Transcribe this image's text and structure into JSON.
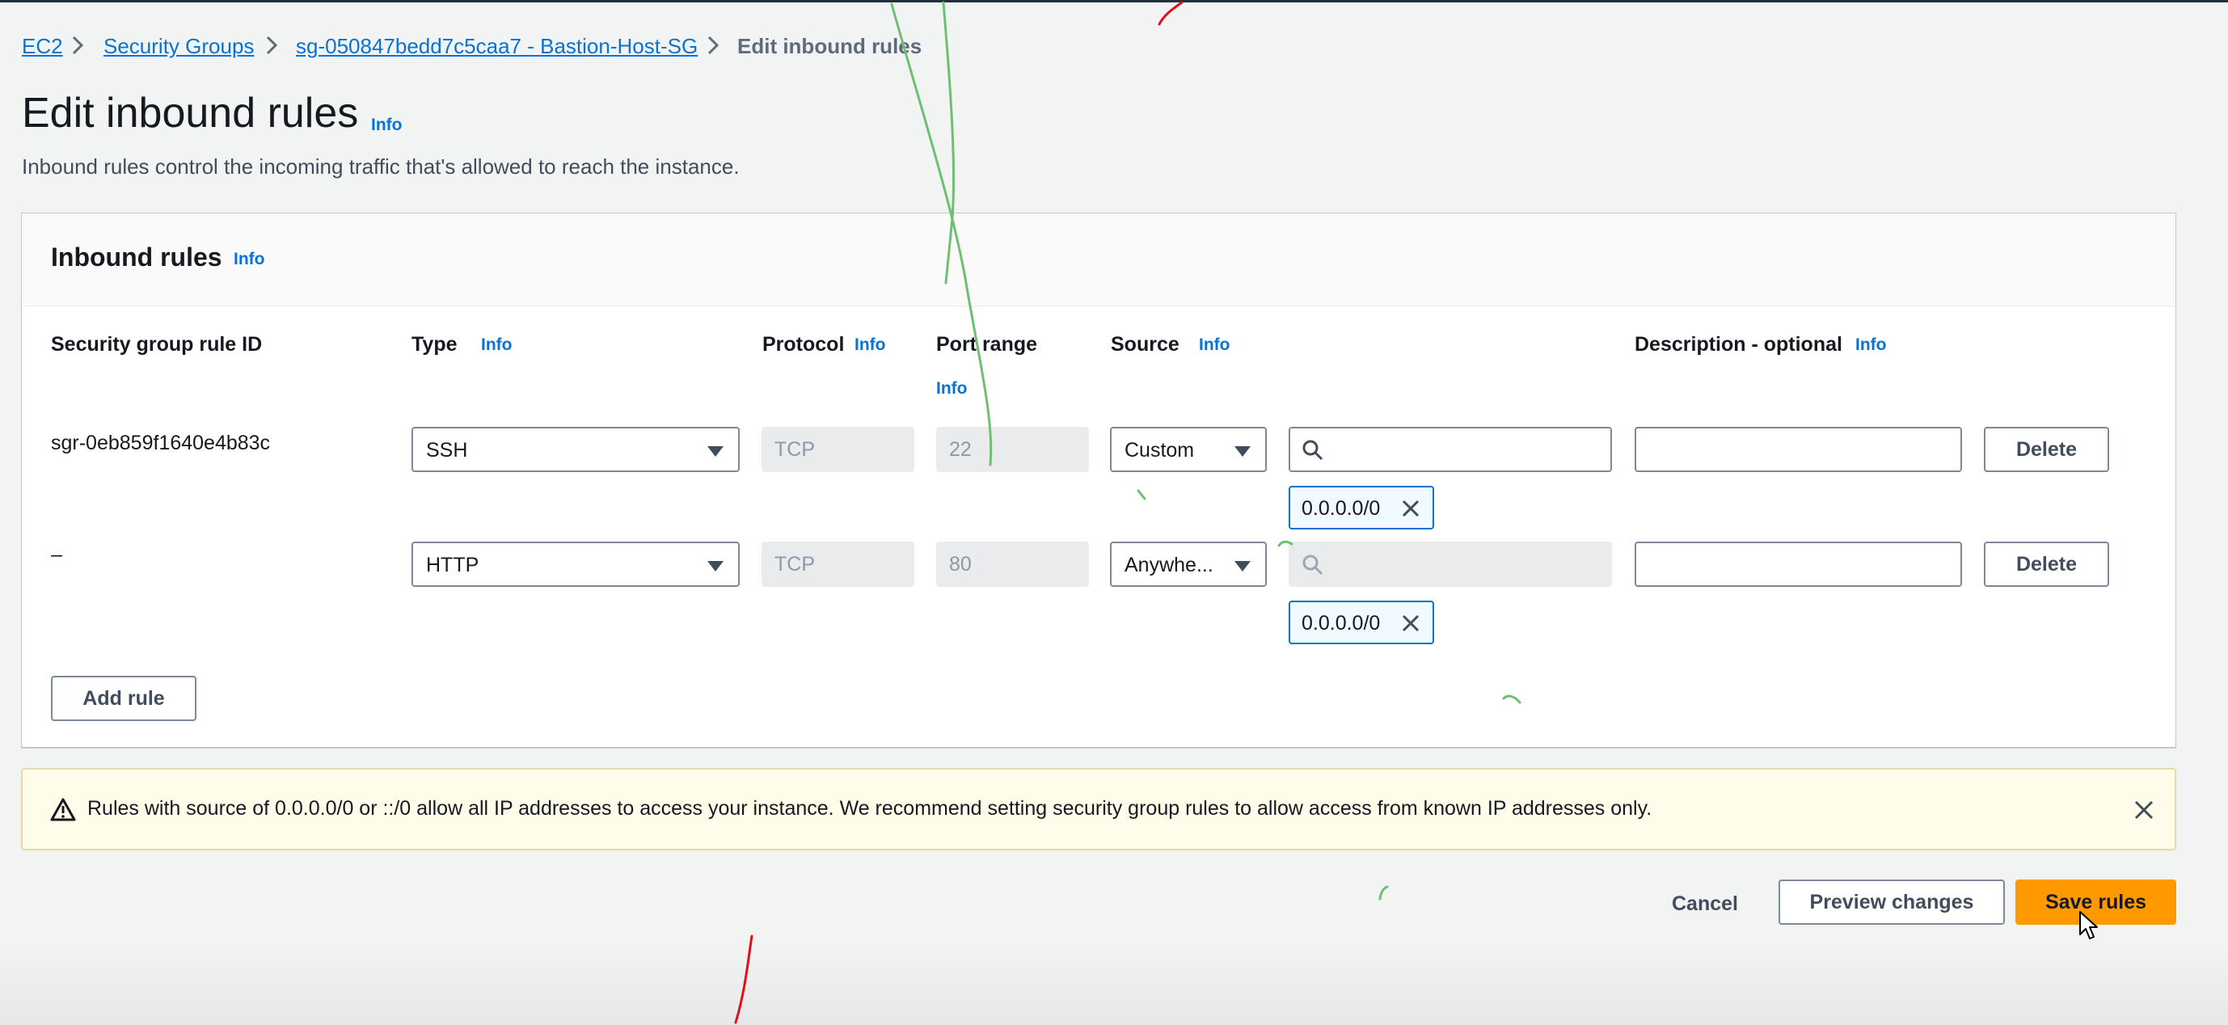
{
  "breadcrumb": {
    "items": [
      "EC2",
      "Security Groups",
      "sg-050847bedd7c5caa7 - Bastion-Host-SG"
    ],
    "current": "Edit inbound rules"
  },
  "page": {
    "title": "Edit inbound rules",
    "info": "Info",
    "subtitle": "Inbound rules control the incoming traffic that's allowed to reach the instance."
  },
  "panel": {
    "title": "Inbound rules",
    "info": "Info",
    "columns": {
      "rule_id": "Security group rule ID",
      "type": "Type",
      "protocol": "Protocol",
      "port_range": "Port range",
      "source": "Source",
      "description": "Description - optional",
      "info": "Info"
    },
    "rows": [
      {
        "rule_id": "sgr-0eb859f1640e4b83c",
        "type": "SSH",
        "protocol": "TCP",
        "port": "22",
        "source": "Custom",
        "cidr": "0.0.0.0/0",
        "description": "",
        "delete": "Delete"
      },
      {
        "rule_id": "–",
        "type": "HTTP",
        "protocol": "TCP",
        "port": "80",
        "source": "Anywhe...",
        "cidr": "0.0.0.0/0",
        "description": "",
        "delete": "Delete"
      }
    ],
    "add_rule": "Add rule"
  },
  "alert": {
    "text": "Rules with source of 0.0.0.0/0 or ::/0 allow all IP addresses to access your instance. We recommend setting security group rules to allow access from known IP addresses only."
  },
  "footer": {
    "cancel": "Cancel",
    "preview": "Preview changes",
    "save": "Save rules"
  },
  "colors": {
    "link": "#0972d3",
    "primary": "#ff9900",
    "warning_bg": "#fffce9",
    "annotation_green": "#6fbf73",
    "annotation_red": "#e0101a"
  }
}
